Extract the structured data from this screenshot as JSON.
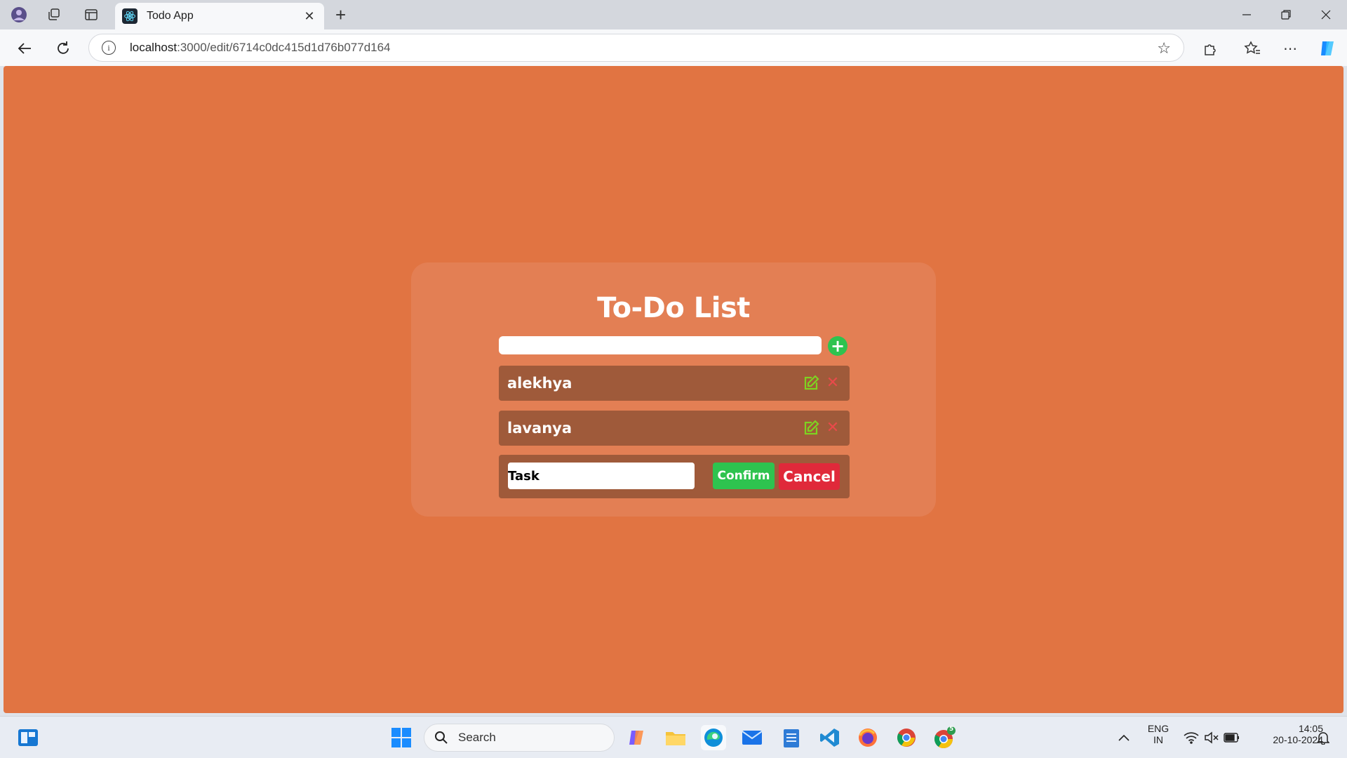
{
  "browser": {
    "tab_title": "Todo App",
    "url_host": "localhost",
    "url_path": ":3000/edit/6714c0dc415d1d76b077d164"
  },
  "app": {
    "title": "To-Do List",
    "add_input_value": "",
    "add_button_label": "+",
    "todos": [
      {
        "text": "alekhya"
      },
      {
        "text": "lavanya"
      }
    ],
    "edit_row": {
      "input_value": "Task",
      "confirm_label": "Confirm",
      "cancel_label": "Cancel"
    }
  },
  "taskbar": {
    "search_placeholder": "Search",
    "language_line1": "ENG",
    "language_line2": "IN",
    "time": "14:05",
    "date": "20-10-2024",
    "chrome_badge": "5"
  },
  "colors": {
    "page_bg": "#e17442",
    "card_bg": "#e37f54",
    "item_bg": "#9f5a3a",
    "confirm": "#2ec34f",
    "cancel": "#e0293a",
    "delete_icon": "#e84a4a",
    "edit_icon": "#7ed321"
  }
}
